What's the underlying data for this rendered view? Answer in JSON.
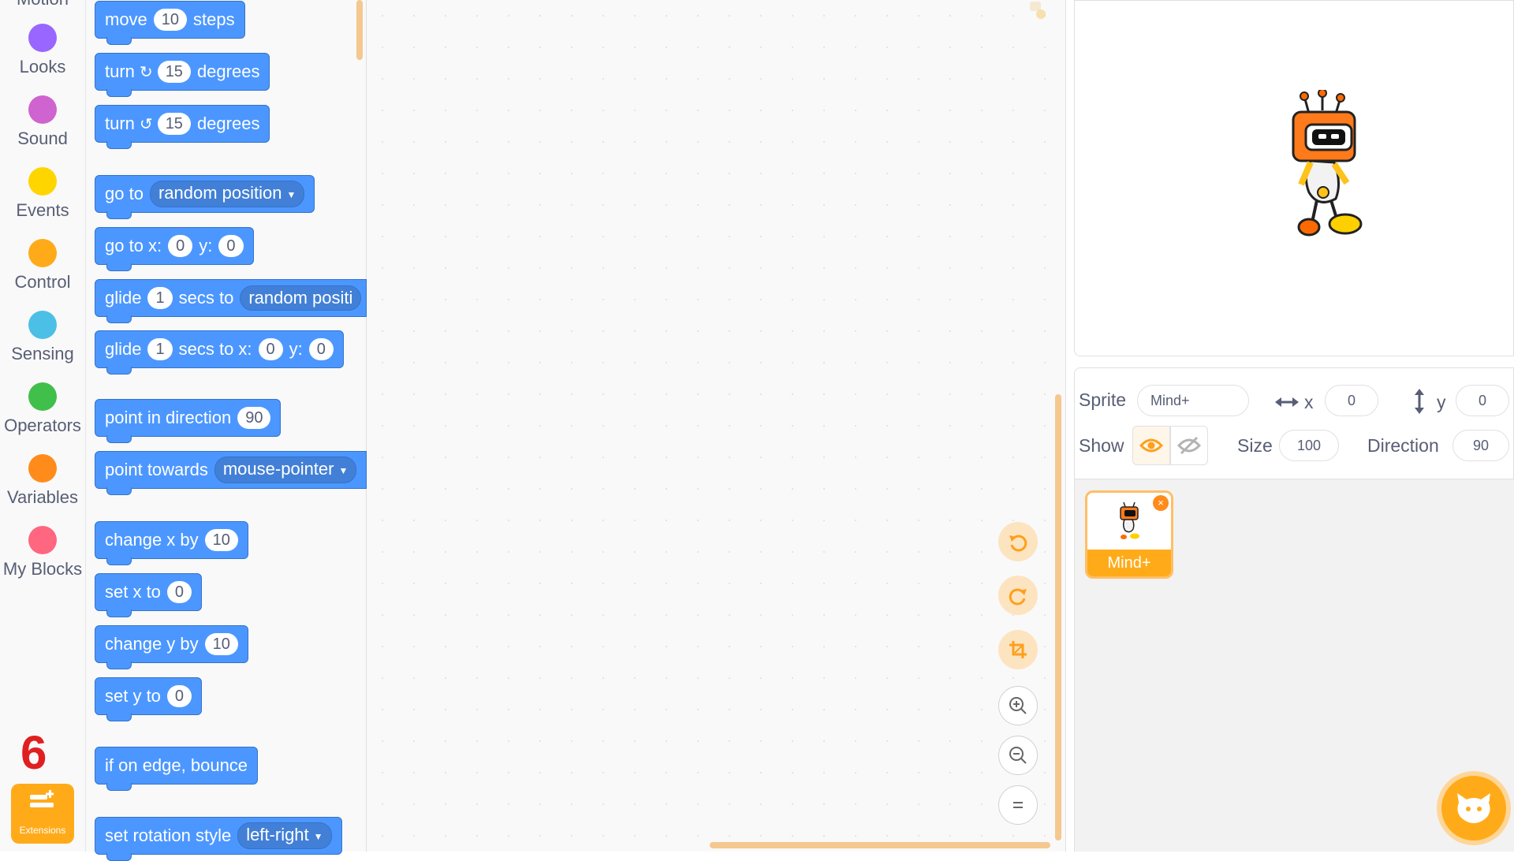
{
  "categories": [
    {
      "label": "Motion",
      "color": "#4c97ff"
    },
    {
      "label": "Looks",
      "color": "#9966ff"
    },
    {
      "label": "Sound",
      "color": "#cf63cf"
    },
    {
      "label": "Events",
      "color": "#ffd500"
    },
    {
      "label": "Control",
      "color": "#ffab19"
    },
    {
      "label": "Sensing",
      "color": "#4cbfe6"
    },
    {
      "label": "Operators",
      "color": "#40bf4a"
    },
    {
      "label": "Variables",
      "color": "#ff8c1a"
    },
    {
      "label": "My Blocks",
      "color": "#ff6680"
    }
  ],
  "badge": "6",
  "extensions_label": "Extensions",
  "blocks": {
    "move": {
      "a": "move",
      "v": "10",
      "b": "steps"
    },
    "turn_cw": {
      "a": "turn",
      "v": "15",
      "b": "degrees"
    },
    "turn_ccw": {
      "a": "turn",
      "v": "15",
      "b": "degrees"
    },
    "goto": {
      "a": "go to",
      "menu": "random position"
    },
    "goto_xy": {
      "a": "go to x:",
      "x": "0",
      "ylabel": "y:",
      "y": "0"
    },
    "glide": {
      "a": "glide",
      "v": "1",
      "b": "secs to",
      "menu": "random positi"
    },
    "glide_xy": {
      "a": "glide",
      "v": "1",
      "b": "secs to x:",
      "x": "0",
      "ylabel": "y:",
      "y": "0"
    },
    "point_dir": {
      "a": "point in direction",
      "v": "90"
    },
    "point_towards": {
      "a": "point towards",
      "menu": "mouse-pointer"
    },
    "change_x": {
      "a": "change x by",
      "v": "10"
    },
    "set_x": {
      "a": "set x to",
      "v": "0"
    },
    "change_y": {
      "a": "change y by",
      "v": "10"
    },
    "set_y": {
      "a": "set y to",
      "v": "0"
    },
    "bounce": {
      "a": "if on edge, bounce"
    },
    "rotation": {
      "a": "set rotation style",
      "menu": "left-right"
    }
  },
  "sprite_info": {
    "sprite_label": "Sprite",
    "sprite_name": "Mind+",
    "x_label": "x",
    "x_value": "0",
    "y_label": "y",
    "y_value": "0",
    "show_label": "Show",
    "size_label": "Size",
    "size_value": "100",
    "direction_label": "Direction",
    "direction_value": "90"
  },
  "sprite_list": {
    "card_name": "Mind+",
    "delete_icon": "×"
  },
  "colors": {
    "motion_block": "#4c97ff",
    "accent_orange": "#ffab19"
  }
}
